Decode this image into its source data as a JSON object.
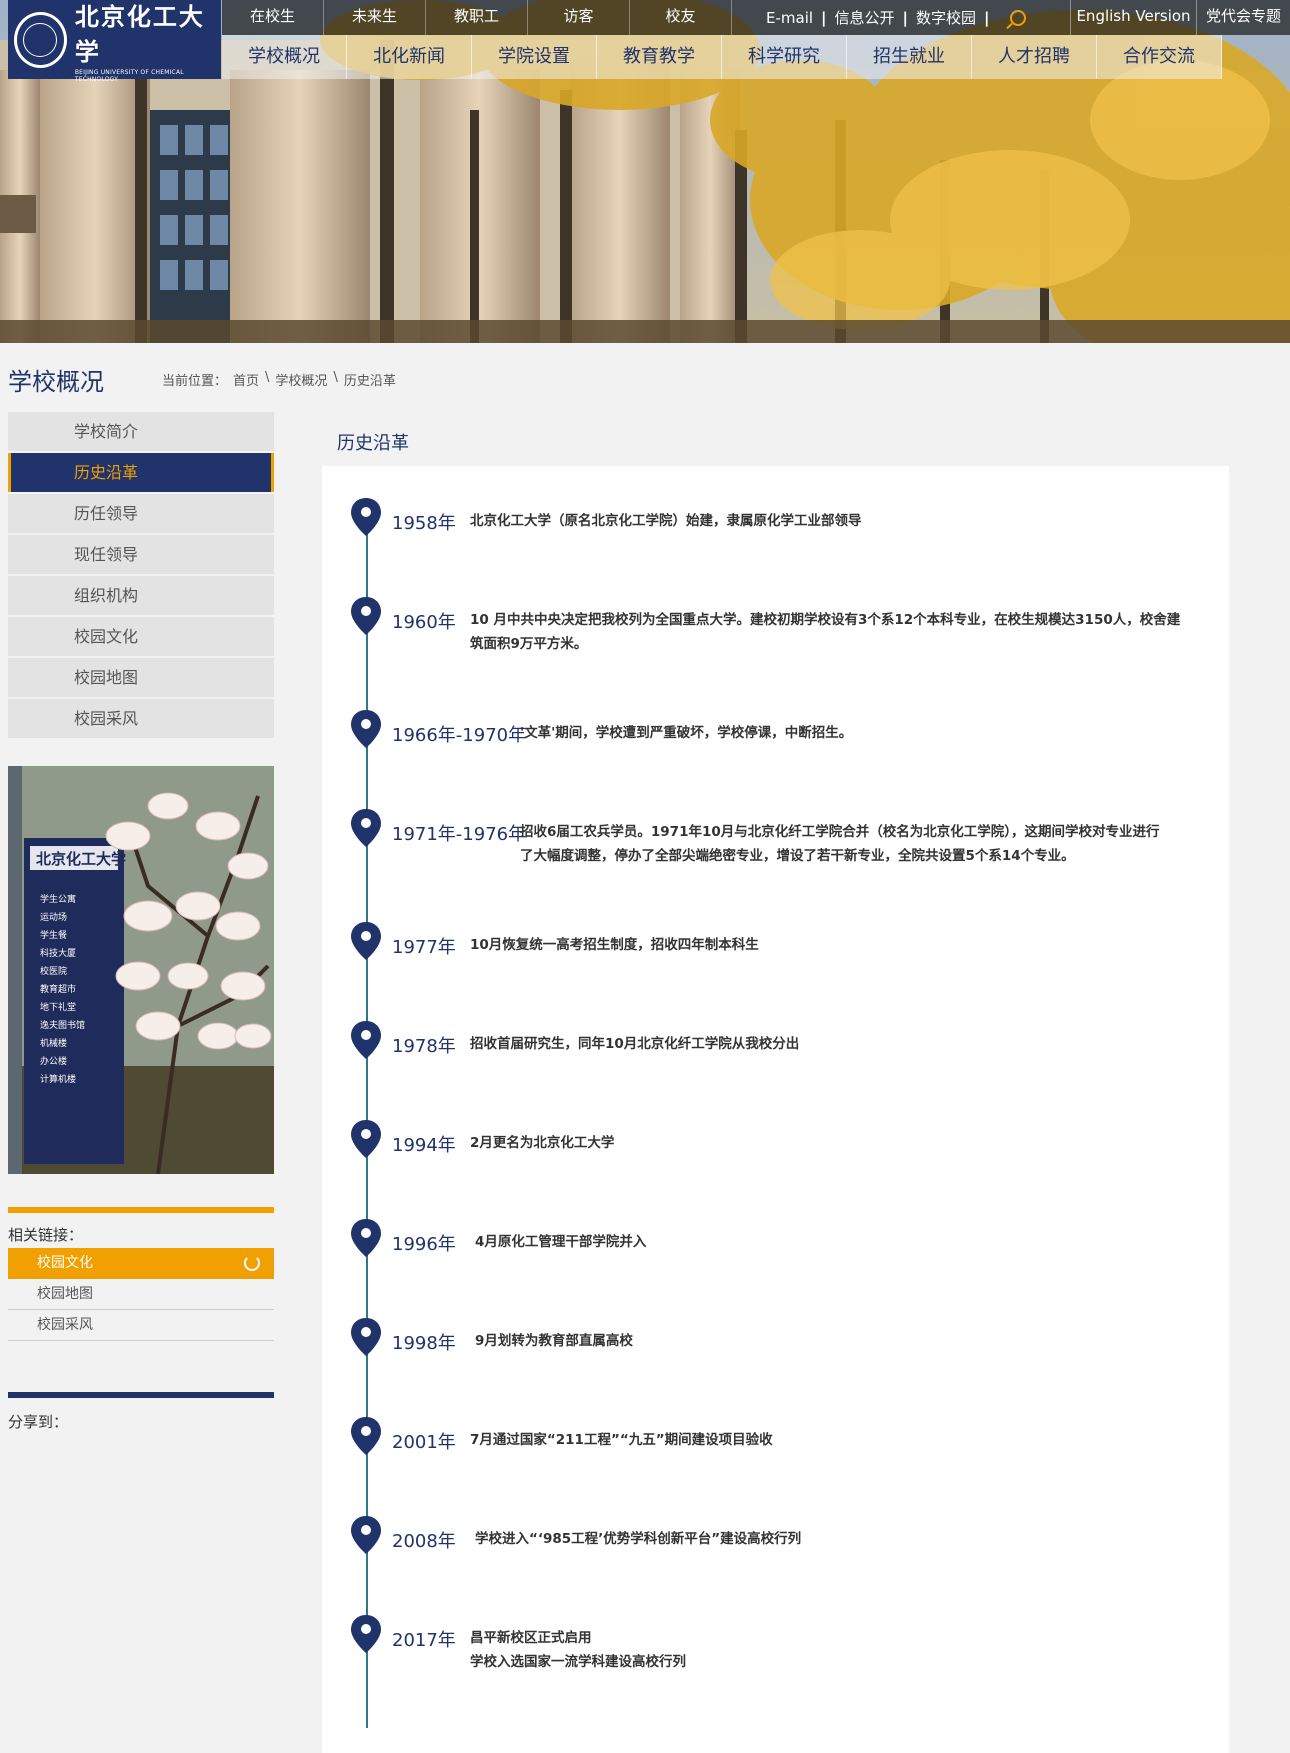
{
  "logo": {
    "name_cn": "北京化工大学",
    "name_en": "BEIJING UNIVERSITY OF CHEMICAL TECHNOLOGY"
  },
  "top_nav": [
    "在校生",
    "未来生",
    "教职工",
    "访客",
    "校友"
  ],
  "top_links": [
    "E-mail",
    "信息公开",
    "数字校园"
  ],
  "language": {
    "english": "English Version",
    "party": "党代会专题"
  },
  "main_nav": [
    "学校概况",
    "北化新闻",
    "学院设置",
    "教育教学",
    "科学研究",
    "招生就业",
    "人才招聘",
    "合作交流"
  ],
  "section_title": "学校概况",
  "breadcrumb": {
    "label": "当前位置：",
    "items": [
      "首页",
      "学校概况",
      "历史沿革"
    ],
    "sep": "\\"
  },
  "side_menu": [
    "学校简介",
    "历史沿革",
    "历任领导",
    "现任领导",
    "组织机构",
    "校园文化",
    "校园地图",
    "校园采风"
  ],
  "side_menu_active": 1,
  "photo_sign": {
    "title": "北京化工大学",
    "rows": [
      "学生公寓",
      "运动场",
      "学生餐",
      "科技大厦",
      "校医院",
      "教育超市",
      "地下礼堂",
      "逸夫图书馆",
      "机械楼",
      "办公楼",
      "计算机楼"
    ]
  },
  "related_links": {
    "title": "相关链接：",
    "items": [
      "校园文化",
      "校园地图",
      "校园采风"
    ]
  },
  "share": {
    "title": "分享到："
  },
  "content_title": "历史沿革",
  "timeline": [
    {
      "year": "1958年",
      "text": [
        "北京化工大学（原名北京化工学院）始建，隶属原化学工业部领导"
      ]
    },
    {
      "year": "1960年",
      "text": [
        "10 月中共中央决定把我校列为全国重点大学。建校初期学校设有3个系12个本科专业，在校生规模达3150人，校舍建",
        "筑面积9万平方米。"
      ]
    },
    {
      "year": "1966年-1970年",
      "text": [
        "'文革'期间，学校遭到严重破坏，学校停课，中断招生。"
      ]
    },
    {
      "year": "1971年-1976年",
      "text": [
        "招收6届工农兵学员。1971年10月与北京化纤工学院合并（校名为北京化工学院），这期间学校对专业进行",
        "了大幅度调整，停办了全部尖端绝密专业，增设了若干新专业，全院共设置5个系14个专业。"
      ]
    },
    {
      "year": "1977年",
      "text": [
        "10月恢复统一高考招生制度，招收四年制本科生"
      ]
    },
    {
      "year": "1978年",
      "text": [
        "招收首届研究生，同年10月北京化纤工学院从我校分出"
      ]
    },
    {
      "year": "1994年",
      "text": [
        "2月更名为北京化工大学"
      ]
    },
    {
      "year": "1996年",
      "text": [
        "4月原化工管理干部学院并入"
      ]
    },
    {
      "year": "1998年",
      "text": [
        "9月划转为教育部直属高校"
      ]
    },
    {
      "year": "2001年",
      "text": [
        "7月通过国家“211工程”“九五”期间建设项目验收"
      ]
    },
    {
      "year": "2008年",
      "text": [
        "学校进入“‘985工程’优势学科创新平台”建设高校行列"
      ]
    },
    {
      "year": "2017年",
      "text": [
        "昌平新校区正式启用",
        "学校入选国家一流学科建设高校行列"
      ]
    }
  ],
  "colors": {
    "navy": "#20336b",
    "accent": "#f0a000",
    "timeline": "#2a7a8a"
  }
}
